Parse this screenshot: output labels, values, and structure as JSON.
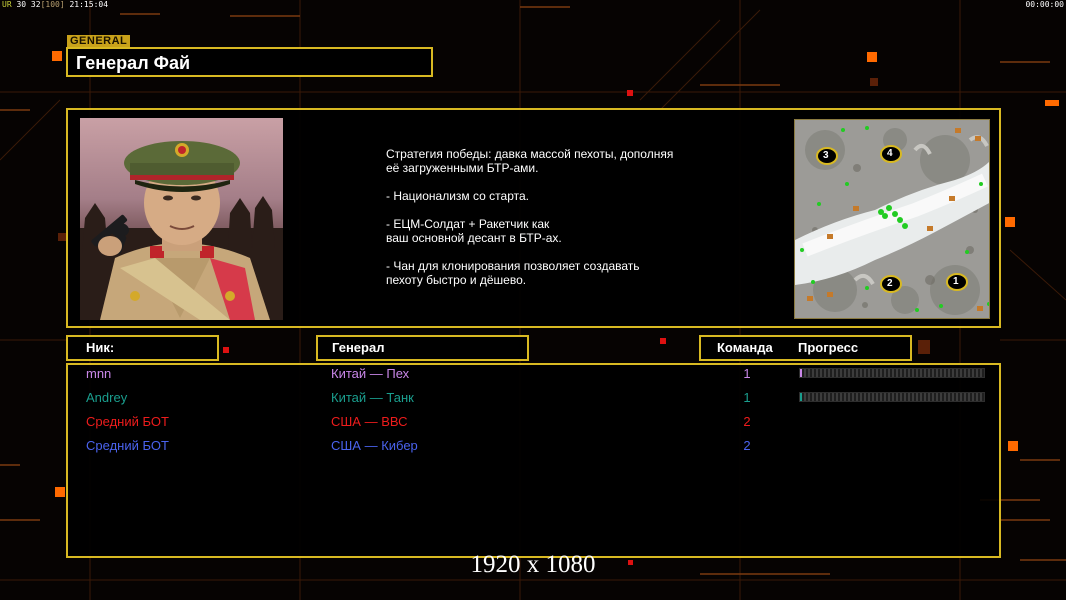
{
  "status_bar": {
    "left_ur": "UR",
    "left_values": "30 32",
    "left_bracket": "[100]",
    "left_time": "21:15:04",
    "right_time": "00:00:00"
  },
  "general_tag": "GENERAL",
  "title": "Генерал Фай",
  "description": "Стратегия победы: давка массой пехоты, дополняя\n её загруженными БТР-ами.\n\n- Национализм со старта.\n\n- ЕЦМ-Солдат + Ракетчик как\nваш основной десант в БТР-ах.\n\n- Чан для клонирования позволяет создавать\n пехоту быстро и дёшево.",
  "minimap": {
    "start_positions": [
      "3",
      "4",
      "2",
      "1"
    ]
  },
  "headers": {
    "nick": "Ник:",
    "general": "Генерал",
    "team": "Команда",
    "progress": "Прогресс"
  },
  "players": [
    {
      "nick": "mnn",
      "general": "Китай — Пех",
      "team": "1",
      "color": "#c987e8",
      "progress": 0.01
    },
    {
      "nick": "Andrey",
      "general": "Китай — Танк",
      "team": "1",
      "color": "#1a9e8e",
      "progress": 0.005
    },
    {
      "nick": "Средний БОТ",
      "general": "США — ВВС",
      "team": "2",
      "color": "#ee1c1c"
    },
    {
      "nick": "Средний БОТ",
      "general": "США — Кибер",
      "team": "2",
      "color": "#4a63ee"
    }
  ],
  "resolution_label": "1920 x 1080",
  "colors": {
    "accent_gold": "#d8b922",
    "accent_orange": "#ff6a00"
  }
}
